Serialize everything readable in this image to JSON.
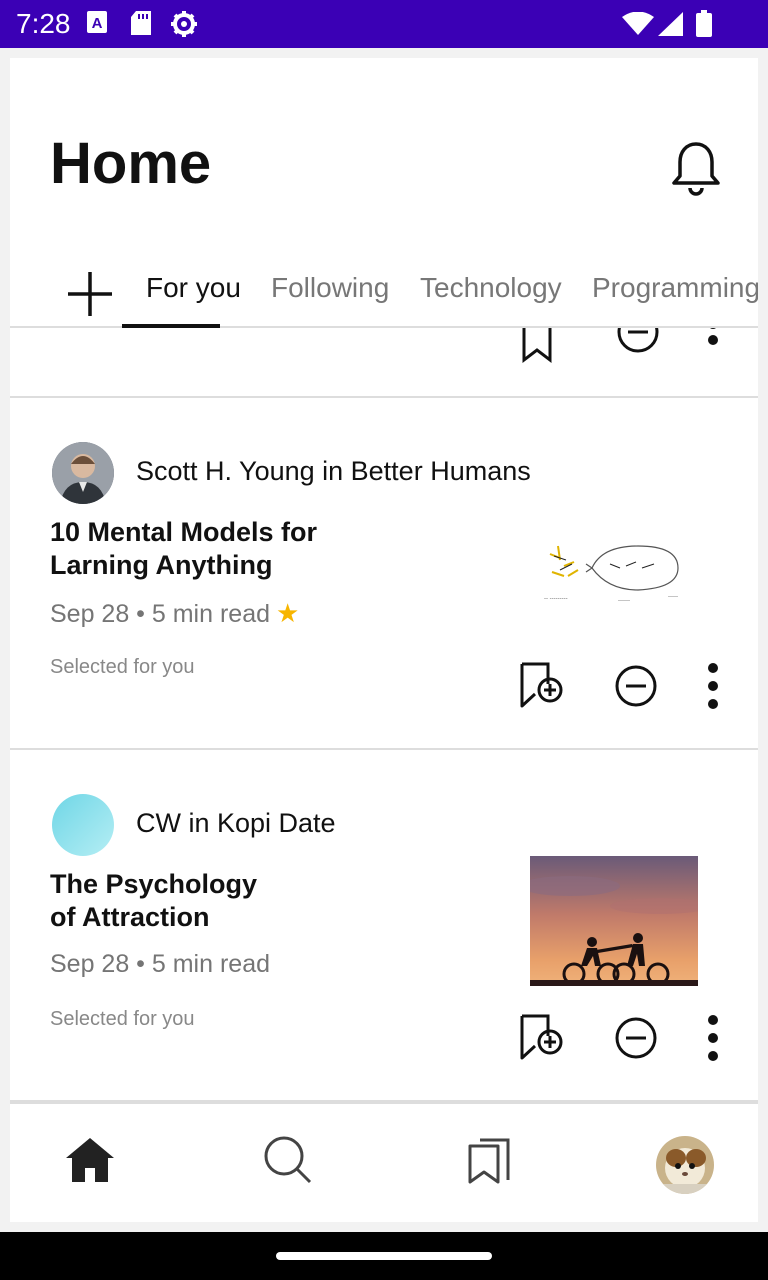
{
  "status_bar": {
    "time": "7:28"
  },
  "header": {
    "title": "Home"
  },
  "tabs": [
    {
      "label": "For you",
      "active": true
    },
    {
      "label": "Following",
      "active": false
    },
    {
      "label": "Technology",
      "active": false
    },
    {
      "label": "Programming",
      "active": false
    }
  ],
  "articles": [
    {
      "author": "Scott H. Young in Better Humans",
      "title": "10 Mental Models for Larning Anything",
      "meta": "Sep 28 • 5 min read",
      "starred": true,
      "selected_label": "Selected for you"
    },
    {
      "author": "CW in Kopi Date",
      "title": "The Psychology of Attraction",
      "meta": "Sep 28 • 5 min read",
      "starred": false,
      "selected_label": "Selected for you"
    }
  ],
  "bottom_nav": [
    "home-icon",
    "search-icon",
    "bookmarks-icon",
    "profile-avatar"
  ],
  "colors": {
    "status_bar": "#3b00b5",
    "star": "#f7b500",
    "text": "#111111",
    "muted": "#757575"
  }
}
